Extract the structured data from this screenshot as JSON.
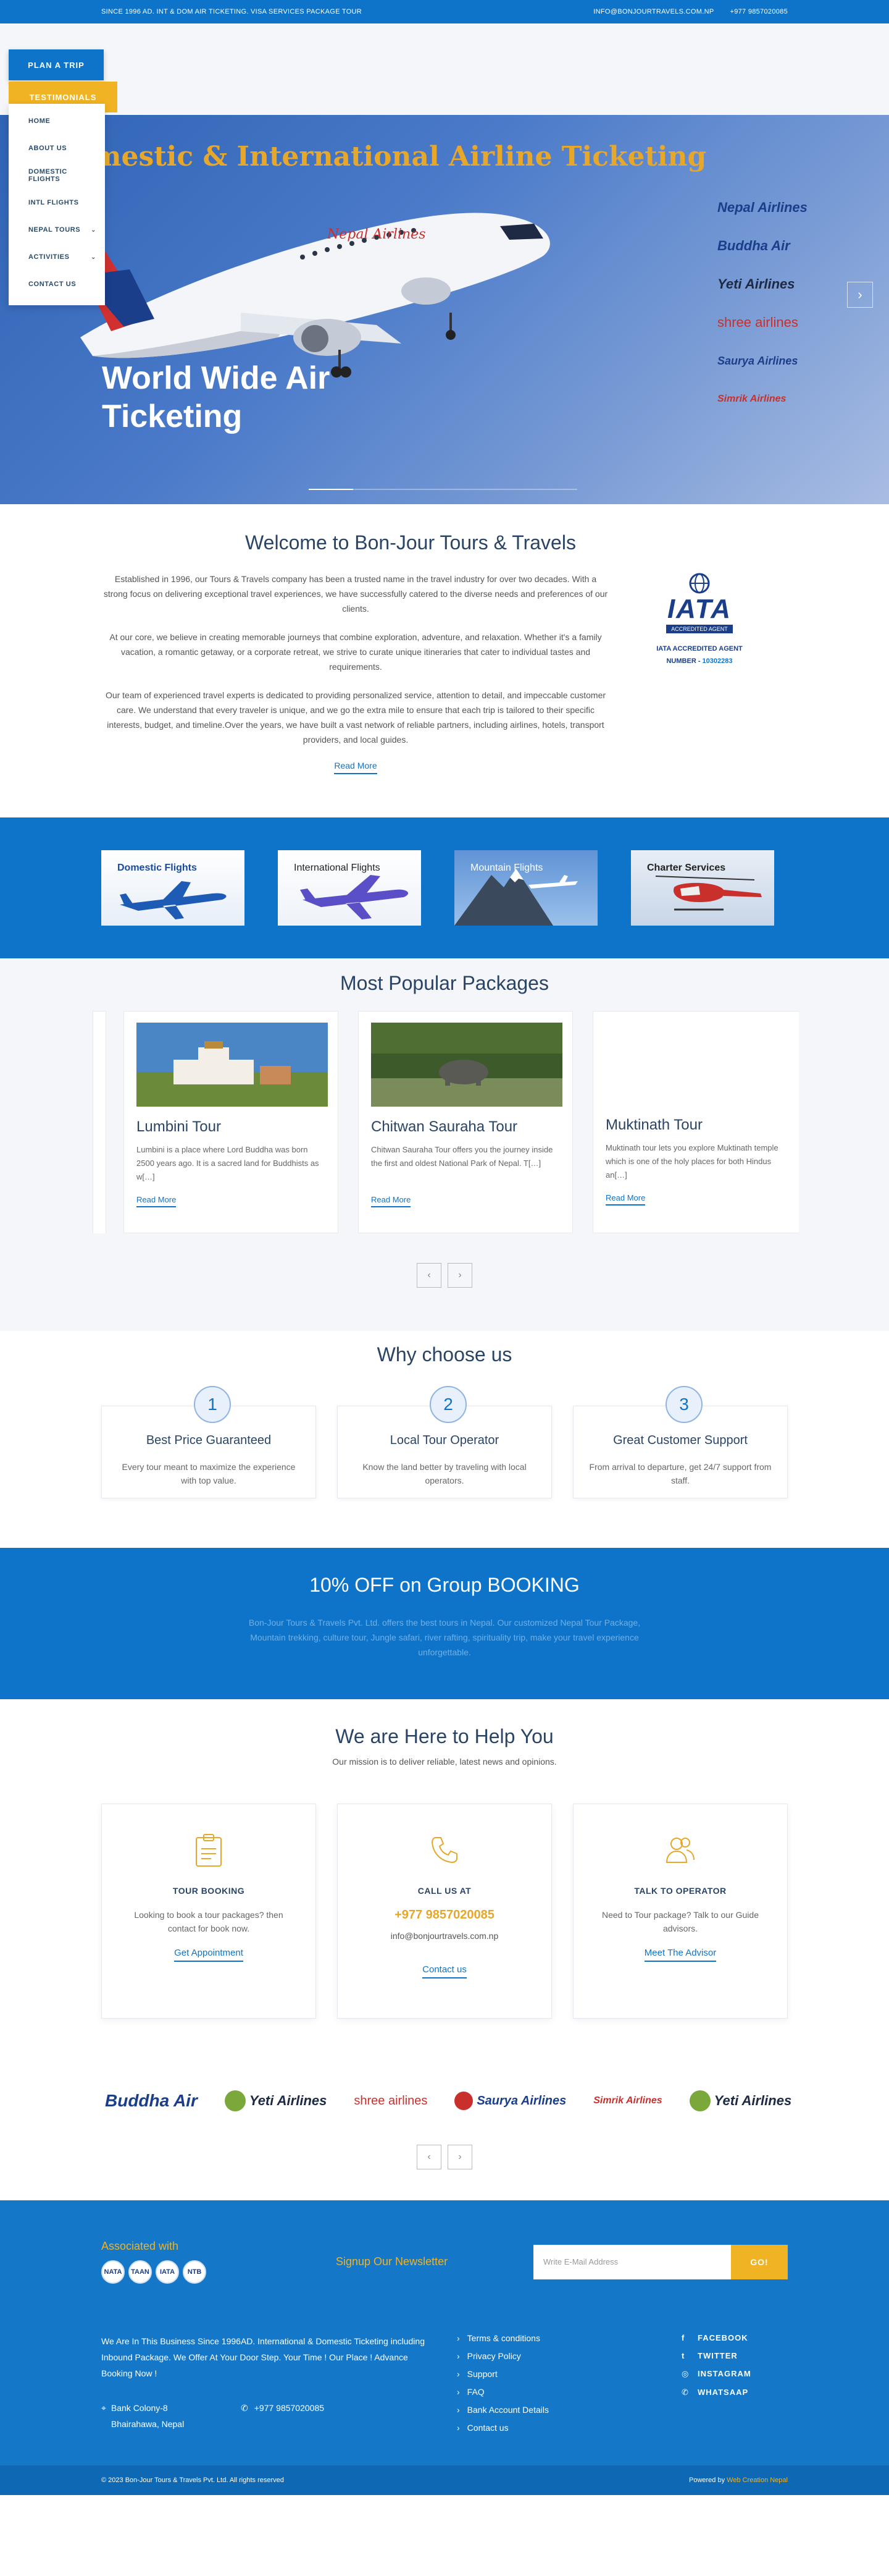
{
  "topbar": {
    "left": "SINCE 1996 AD. INT & DOM AIR TICKETING. VISA SERVICES PACKAGE TOUR",
    "email": "INFO@BONJOURTRAVELS.COM.NP",
    "phone": "+977 9857020085"
  },
  "header": {
    "plan_trip": "PLAN A TRIP",
    "testimonials": "TESTIMONIALS"
  },
  "nav": {
    "items": [
      {
        "label": "HOME"
      },
      {
        "label": "ABOUT US"
      },
      {
        "label": "DOMESTIC FLIGHTS"
      },
      {
        "label": "INTL FLIGHTS"
      },
      {
        "label": "NEPAL TOURS",
        "caret": "⌄"
      },
      {
        "label": "ACTIVITIES",
        "caret": "⌄"
      },
      {
        "label": "CONTACT US"
      }
    ]
  },
  "hero": {
    "banner_title": "mestic & International Airline Ticketing",
    "caption": "World Wide Air Ticketing",
    "next": "›",
    "airlines": [
      {
        "name": "Nepal Airlines",
        "color": "#1a3e8a"
      },
      {
        "name": "Buddha Air",
        "color": "#1a3e8a"
      },
      {
        "name": "Yeti Airlines",
        "color": "#1e2a44"
      },
      {
        "name": "shree airlines",
        "color": "#c9302c"
      },
      {
        "name": "Saurya Airlines",
        "color": "#1a3e8a"
      },
      {
        "name": "Simrik Airlines",
        "color": "#c9302c"
      }
    ]
  },
  "welcome": {
    "title": "Welcome to Bon-Jour Tours & Travels",
    "p1": "Established in 1996, our Tours & Travels company has been a trusted name in the travel industry for over two decades. With a strong focus on delivering exceptional travel experiences, we have successfully catered to the diverse needs and preferences of our clients.",
    "p2": "At our core, we believe in creating memorable journeys that combine exploration, adventure, and relaxation. Whether it's a family vacation, a romantic getaway, or a corporate retreat, we strive to curate unique itineraries that cater to individual tastes and requirements.",
    "p3": "Our team of experienced travel experts is dedicated to providing personalized service, attention to detail, and impeccable customer care. We understand that every traveler is unique, and we go the extra mile to ensure that each trip is tailored to their specific interests, budget, and timeline.Over the years, we have built a vast network of reliable partners, including airlines, hotels, transport providers, and local guides.",
    "read_more": "Read More",
    "iata": {
      "logo": "IATA",
      "logo_sub": "ACCREDITED AGENT",
      "line1": "IATA ACCREDITED AGENT",
      "number_label": "NUMBER - ",
      "number": "10302283"
    }
  },
  "services": [
    {
      "label": "Domestic Flights"
    },
    {
      "label": "International Flights"
    },
    {
      "label": "Mountain Flights"
    },
    {
      "label": "Charter Services"
    }
  ],
  "packages": {
    "title": "Most Popular Packages",
    "items": [
      {
        "name": "Lumbini Tour",
        "desc": "Lumbini is a place where Lord Buddha was born 2500 years ago. It is a sacred land for Buddhists as w[…]",
        "more": "Read More"
      },
      {
        "name": "Chitwan Sauraha Tour",
        "desc": "Chitwan Sauraha Tour offers you the journey inside the first and oldest National Park of Nepal. T[…]",
        "more": "Read More"
      },
      {
        "name": "Muktinath Tour",
        "desc": "Muktinath tour lets you explore Muktinath temple which is one of the holy places for both Hindus an[…]",
        "more": "Read More"
      }
    ],
    "prev": "‹",
    "next": "›"
  },
  "why": {
    "title": "Why choose us",
    "items": [
      {
        "num": "1",
        "title": "Best Price Guaranteed",
        "desc": "Every tour meant to maximize the experience with top value."
      },
      {
        "num": "2",
        "title": "Local Tour Operator",
        "desc": "Know the land better by traveling with local operators."
      },
      {
        "num": "3",
        "title": "Great Customer Support",
        "desc": "From arrival to departure, get 24/7 support from staff."
      }
    ]
  },
  "offer": {
    "title": "10% OFF on Group BOOKING",
    "text": "Bon-Jour Tours & Travels Pvt. Ltd. offers the best tours in Nepal. Our customized Nepal Tour Package, Mountain trekking, culture tour, Jungle safari, river rafting, spirituality trip, make your travel experience unforgettable."
  },
  "help": {
    "title": "We are Here to Help You",
    "subtitle": "Our mission is to deliver reliable, latest news and opinions.",
    "cards": [
      {
        "title": "TOUR BOOKING",
        "desc": "Looking to book a tour packages? then contact for book now.",
        "link": "Get Appointment"
      },
      {
        "title": "CALL US AT",
        "phone": "+977 9857020085",
        "email": "info@bonjourtravels.com.np",
        "link": "Contact us"
      },
      {
        "title": "TALK TO OPERATOR",
        "desc": "Need to Tour package? Talk to our Guide advisors.",
        "link": "Meet The Advisor"
      }
    ]
  },
  "partners": {
    "items": [
      {
        "name": "Buddha Air",
        "color": "#1a3e8a"
      },
      {
        "name": "Yeti Airlines",
        "color": "#1e2a44"
      },
      {
        "name": "shree airlines",
        "color": "#c9302c"
      },
      {
        "name": "Saurya Airlines",
        "color": "#1a3e8a"
      },
      {
        "name": "Simrik Airlines",
        "color": "#c9302c"
      },
      {
        "name": "Yeti Airlines",
        "color": "#1e2a44"
      }
    ],
    "prev": "‹",
    "next": "›"
  },
  "footer": {
    "associated": "Associated with",
    "badges": [
      "NATA",
      "TAAN",
      "IATA",
      "NTB"
    ],
    "newsletter": "Signup Our Newsletter",
    "email_placeholder": "Write E-Mail Address",
    "go": "GO!",
    "about": "We Are In This Business Since 1996AD. International & Domestic Ticketing including Inbound Package. We Offer At Your Door Step. Your Time ! Our Place ! Advance Booking Now !",
    "address": "Bank Colony-8 Bhairahawa, Nepal",
    "phone": "+977 9857020085",
    "links": [
      "Terms & conditions",
      "Privacy Policy",
      "Support",
      "FAQ",
      "Bank Account Details",
      "Contact us"
    ],
    "social": [
      {
        "icon": "f",
        "label": "FACEBOOK"
      },
      {
        "icon": "t",
        "label": "TWITTER"
      },
      {
        "icon": "◎",
        "label": "INSTAGRAM"
      },
      {
        "icon": "✆",
        "label": "WHATSAAP"
      }
    ],
    "copyright": "© 2023 Bon-Jour Tours & Travels Pvt. Ltd. All rights reserved",
    "powered_label": "Powered by ",
    "powered_by": "Web Creation Nepal"
  },
  "colors": {
    "primary": "#0e74c9",
    "accent": "#f0b323",
    "heading": "#2a4466"
  }
}
